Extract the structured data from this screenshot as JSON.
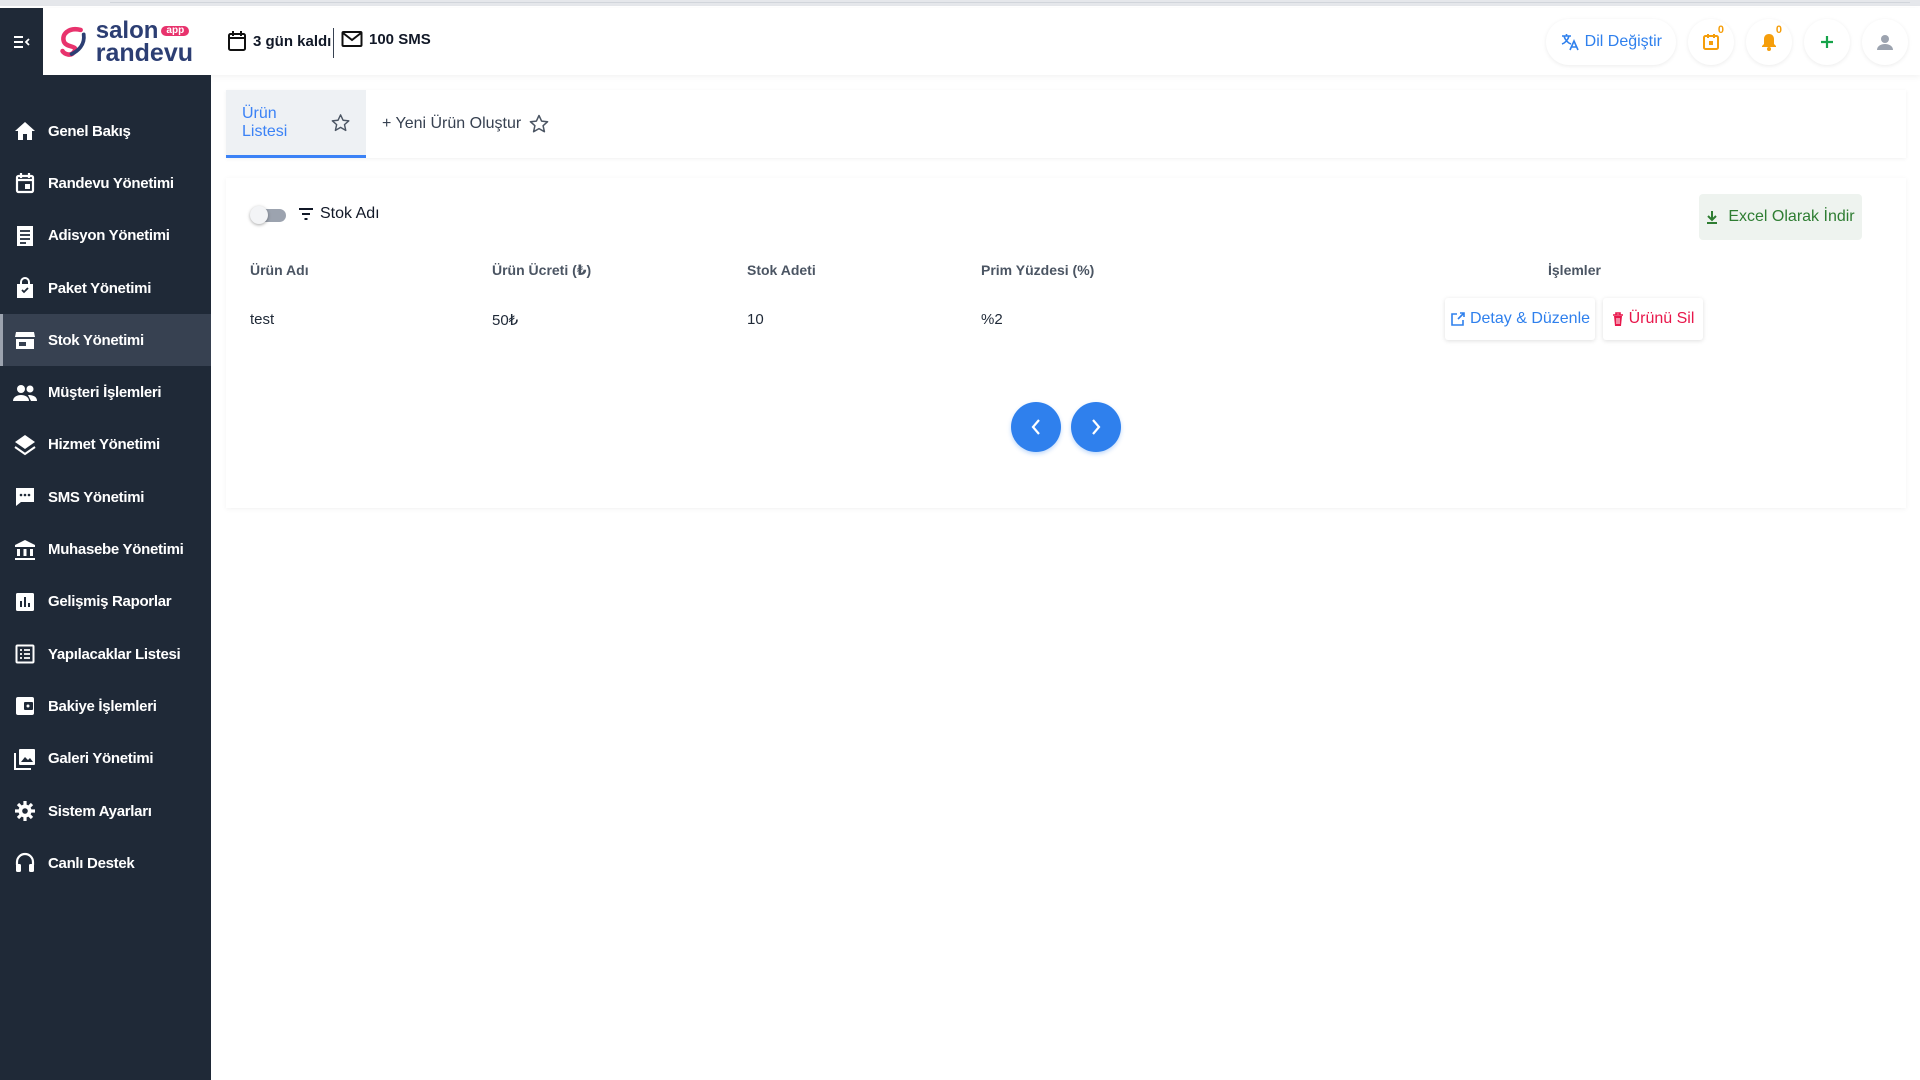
{
  "header": {
    "menu_icon": "menu-collapse-icon",
    "logo": {
      "line1": "salon",
      "badge": "app",
      "line2": "randevu"
    },
    "days_left": "3 gün kaldı",
    "sms_count": "100 SMS",
    "language_button": "Dil Değiştir",
    "calendar_badge": "0",
    "notification_badge": "0",
    "colors": {
      "accent": "#2f80ed",
      "sidebar": "#1f2937",
      "badge": "#f59e0b"
    }
  },
  "sidebar": {
    "items": [
      {
        "label": "Genel Bakış",
        "icon": "home-icon"
      },
      {
        "label": "Randevu Yönetimi",
        "icon": "calendar-icon"
      },
      {
        "label": "Adisyon Yönetimi",
        "icon": "receipt-icon"
      },
      {
        "label": "Paket Yönetimi",
        "icon": "bag-icon"
      },
      {
        "label": "Stok Yönetimi",
        "icon": "store-icon",
        "active": true
      },
      {
        "label": "Müşteri İşlemleri",
        "icon": "users-icon"
      },
      {
        "label": "Hizmet Yönetimi",
        "icon": "layers-icon"
      },
      {
        "label": "SMS Yönetimi",
        "icon": "chat-icon"
      },
      {
        "label": "Muhasebe Yönetimi",
        "icon": "bank-icon"
      },
      {
        "label": "Gelişmiş Raporlar",
        "icon": "chart-icon"
      },
      {
        "label": "Yapılacaklar Listesi",
        "icon": "list-icon"
      },
      {
        "label": "Bakiye İşlemleri",
        "icon": "wallet-icon"
      },
      {
        "label": "Galeri Yönetimi",
        "icon": "gallery-icon"
      },
      {
        "label": "Sistem Ayarları",
        "icon": "gear-icon"
      },
      {
        "label": "Canlı Destek",
        "icon": "headset-icon"
      }
    ]
  },
  "tabs": [
    {
      "label": "Ürün Listesi",
      "active": true
    },
    {
      "label": "+ Yeni Ürün Oluştur",
      "active": false
    }
  ],
  "toolbar": {
    "filter_label": "Stok Adı",
    "excel_button": "Excel Olarak İndir"
  },
  "table": {
    "headers": [
      "Ürün Adı",
      "Ürün Ücreti (₺)",
      "Stok Adeti",
      "Prim Yüzdesi (%)",
      "İşlemler"
    ],
    "rows": [
      {
        "name": "test",
        "price": "50₺",
        "stock": "10",
        "commission": "%2"
      }
    ],
    "edit_button": "Detay & Düzenle",
    "delete_button": "Ürünü Sil"
  }
}
